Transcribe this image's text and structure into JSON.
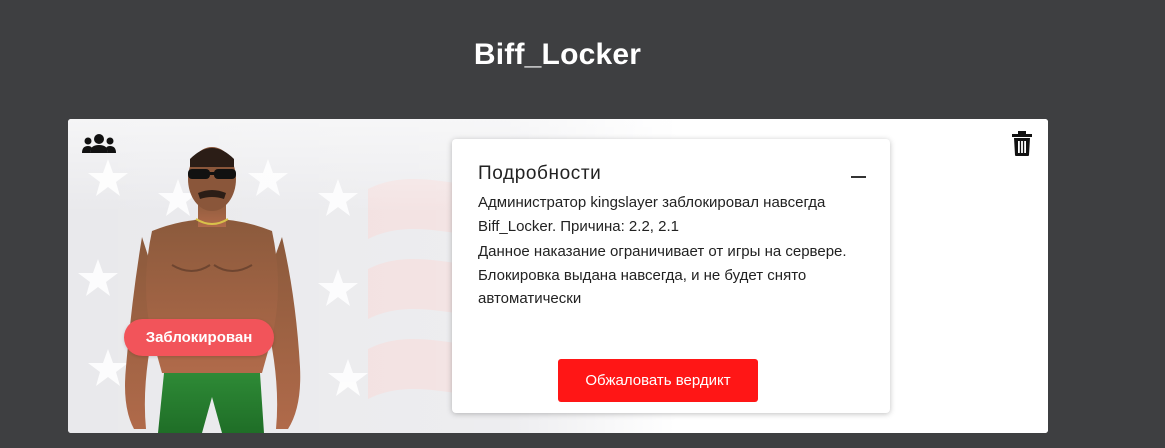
{
  "header": {
    "title": "Biff_Locker"
  },
  "profile": {
    "status_badge": "Заблокирован",
    "group_icon": "users-icon",
    "delete_icon": "trash-icon"
  },
  "details": {
    "title": "Подробности",
    "collapse_icon": "minus-icon",
    "paragraph_1": "Администратор kingslayer заблокировал навсегда Biff_Locker. Причина: 2.2, 2.1",
    "paragraph_2": "Данное наказание ограничивает от игры на сервере. Блокировка выдана навсегда, и не будет снято автоматически",
    "appeal_label": "Обжаловать вердикт"
  },
  "colors": {
    "page_background": "#3e3f41",
    "badge": "#f2545a",
    "appeal_button": "#ff1616"
  }
}
